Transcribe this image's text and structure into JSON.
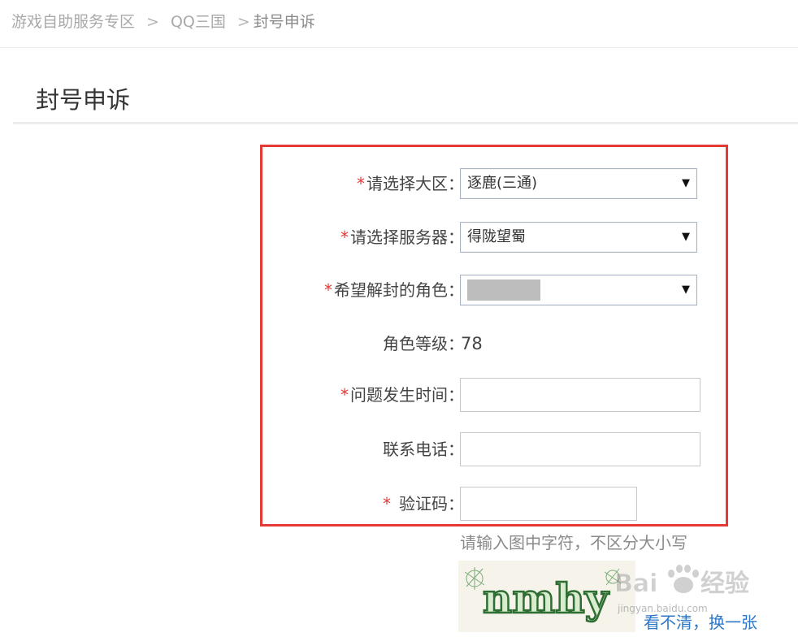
{
  "breadcrumb": {
    "items": [
      "游戏自助服务专区",
      "QQ三国",
      "封号申诉"
    ],
    "separator": ">"
  },
  "page_title": "封号申诉",
  "form": {
    "required_marker": "*",
    "region": {
      "label": "请选择大区：",
      "value": "逐鹿(三通)"
    },
    "server": {
      "label": "请选择服务器：",
      "value": "得陇望蜀"
    },
    "role": {
      "label": "希望解封的角色：",
      "value": ""
    },
    "role_level": {
      "label": "角色等级：",
      "value": "78"
    },
    "issue_time": {
      "label": "问题发生时间：",
      "value": ""
    },
    "phone": {
      "label": "联系电话：",
      "value": ""
    },
    "captcha": {
      "label": "验证码：",
      "value": ""
    }
  },
  "captcha": {
    "hint": "请输入图中字符，不区分大小写",
    "image_text": "nmhy",
    "refresh_link": "看不清，换一张"
  },
  "watermark": {
    "text": "Baidu经验",
    "url_text": "jingyan.baidu.com"
  },
  "colors": {
    "required": "#e53935",
    "highlight_border": "#e53935",
    "link": "#2e78c8"
  }
}
